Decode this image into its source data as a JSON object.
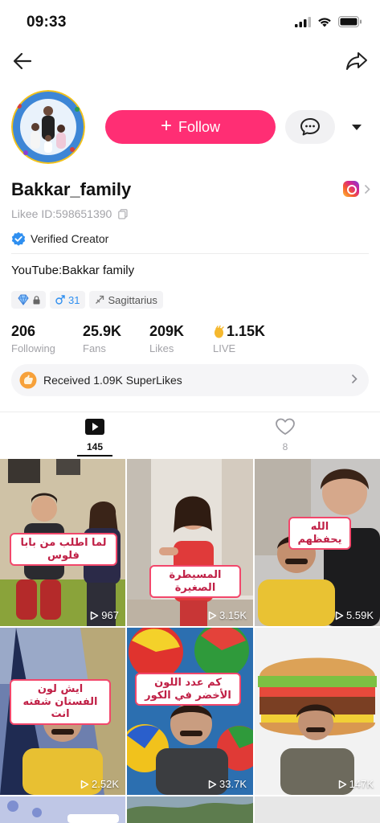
{
  "status": {
    "time": "09:33"
  },
  "profile": {
    "follow_label": "Follow",
    "username": "Bakkar_family",
    "likee_id": "Likee ID:598651390",
    "verified_label": "Verified Creator",
    "bio": "YouTube:Bakkar family",
    "tags": {
      "age": "31",
      "zodiac": "Sagittarius"
    }
  },
  "stats": [
    {
      "value": "206",
      "label": "Following"
    },
    {
      "value": "25.9K",
      "label": "Fans"
    },
    {
      "value": "209K",
      "label": "Likes"
    },
    {
      "value": "1.15K",
      "label": "LIVE"
    }
  ],
  "superlikes": {
    "text": "Received 1.09K SuperLikes"
  },
  "tabs": [
    {
      "icon": "video-play-icon",
      "count": "145"
    },
    {
      "icon": "heart-icon",
      "count": "8"
    }
  ],
  "videos": [
    {
      "caption": "لما اطلب من بابا فلوس",
      "views": "967"
    },
    {
      "caption": "المسيطرة الصغيرة",
      "views": "3.15K"
    },
    {
      "caption": "الله يحفظهم",
      "views": "5.59K"
    },
    {
      "caption": "ايش لون الفستان شفته انت",
      "views": "2.52K"
    },
    {
      "caption": "كم عدد اللون الأخضر في الكور",
      "views": "33.7K"
    },
    {
      "caption": "",
      "views": "147K"
    }
  ],
  "colors": {
    "accent": "#ff2e74",
    "caption_border": "#f2476b",
    "verified": "#2f8ff0"
  }
}
